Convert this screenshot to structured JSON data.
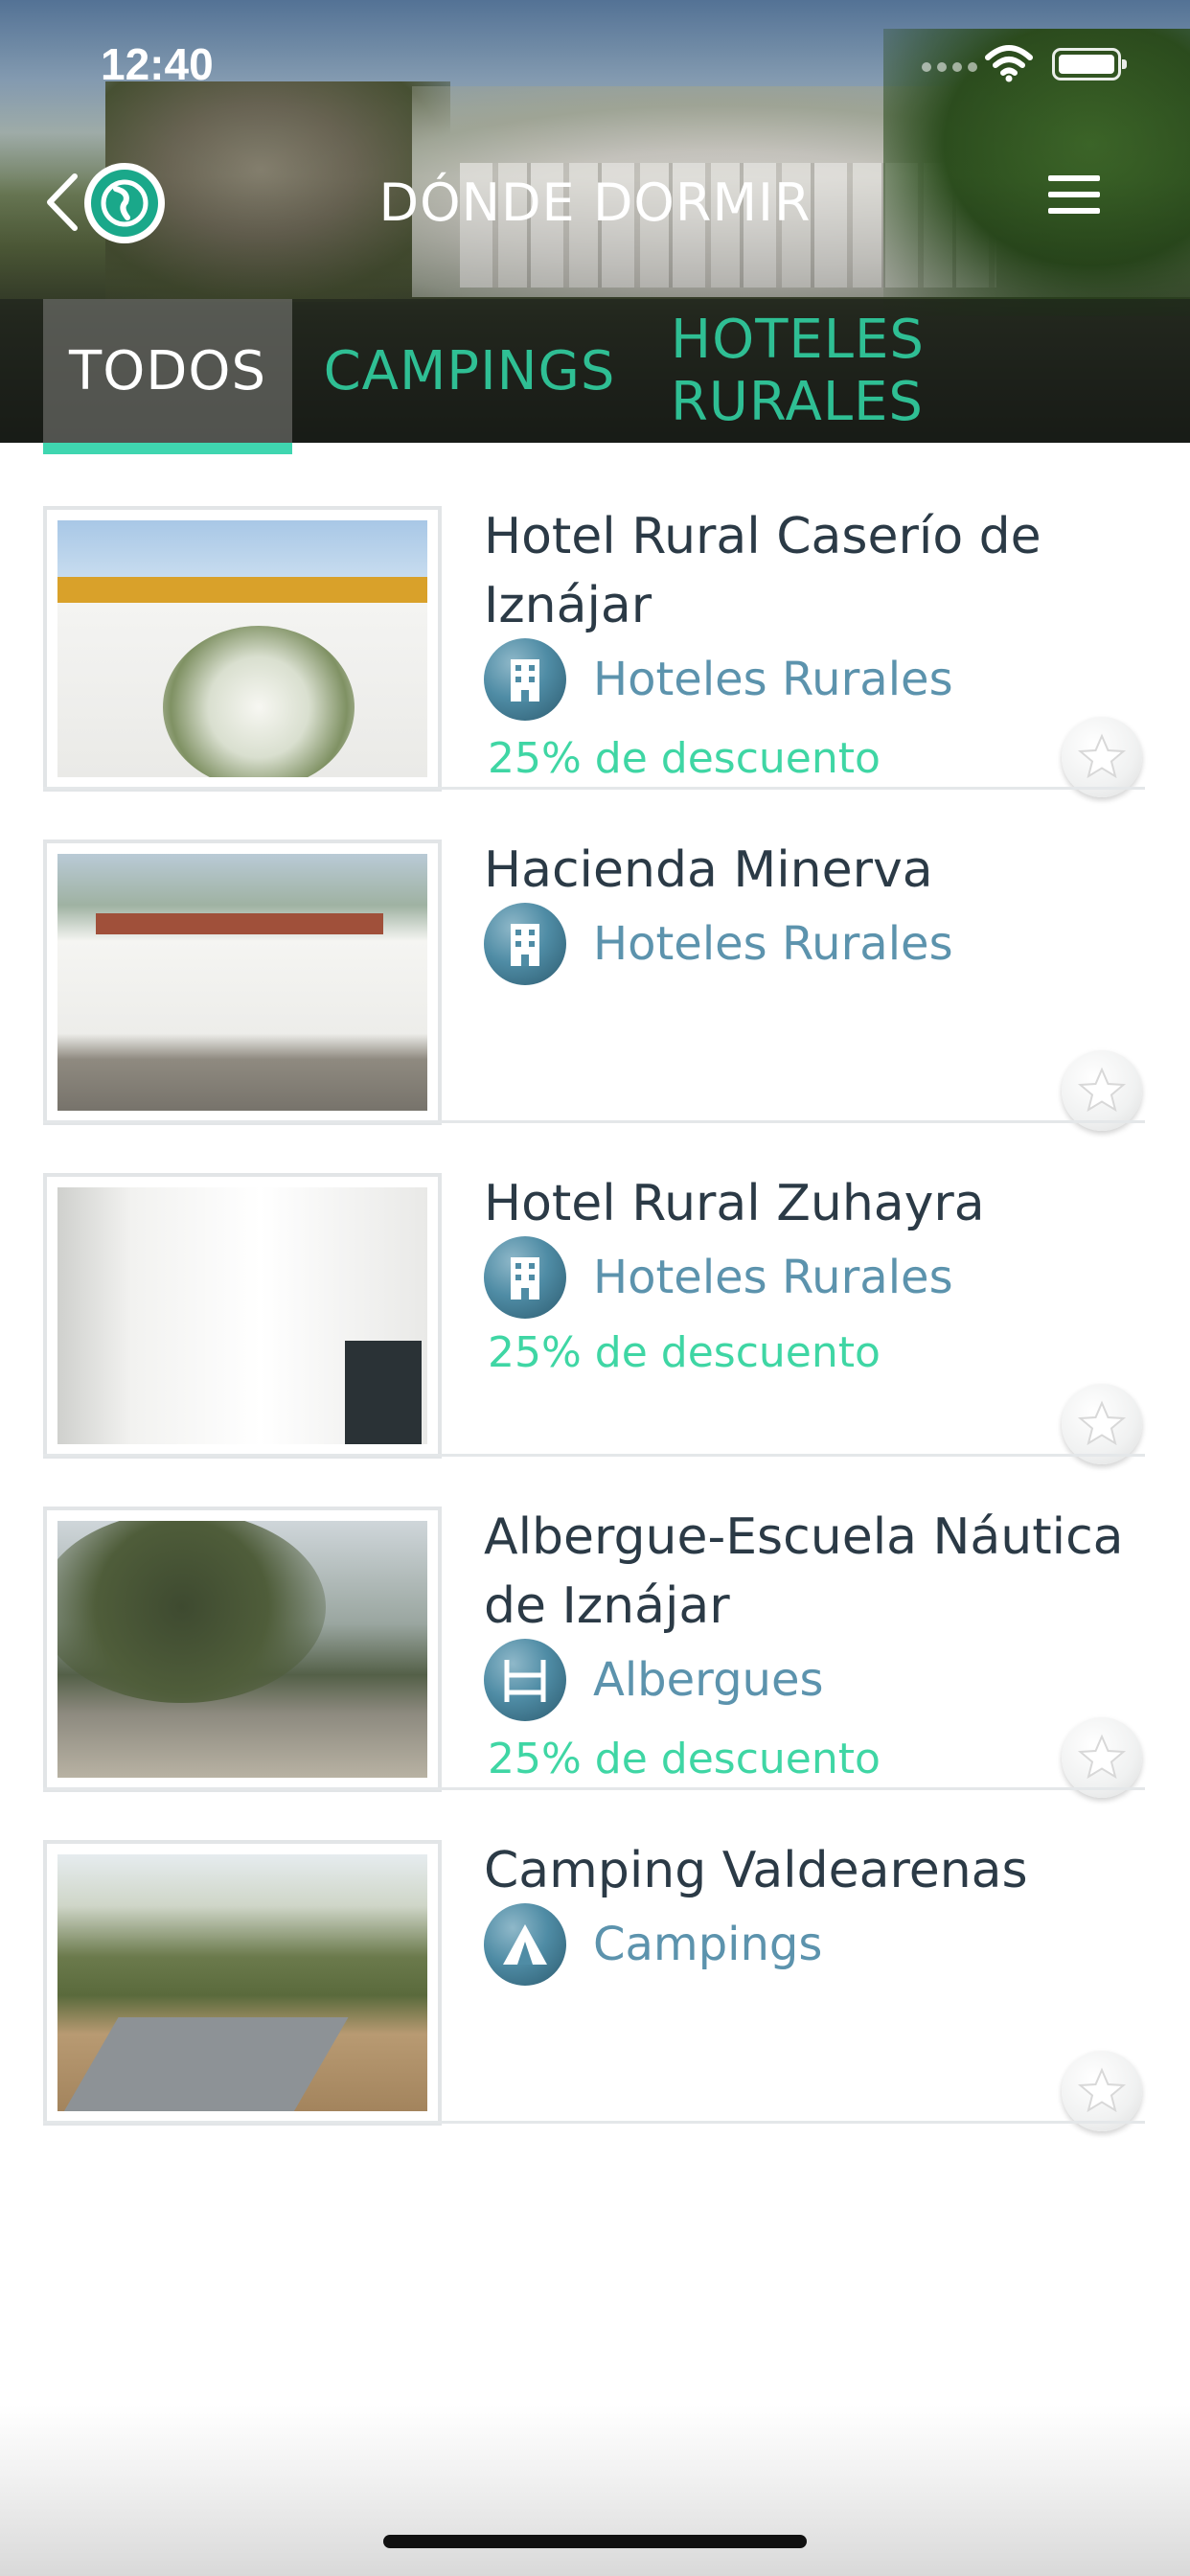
{
  "status_bar": {
    "time": "12:40"
  },
  "header": {
    "title": "DÓNDE DORMIR"
  },
  "tabs": [
    {
      "label": "TODOS",
      "active": true
    },
    {
      "label": "CAMPINGS",
      "active": false
    },
    {
      "label": "HOTELES RURALES",
      "active": false
    }
  ],
  "colors": {
    "accent": "#3fd6b0",
    "tab_inactive": "#2fbf94",
    "category_text": "#5c93ad",
    "discount_text": "#3fd6a4",
    "title_text": "#2b3a46"
  },
  "items": [
    {
      "title": "Hotel Rural Caserío de Iznájar",
      "category": "Hoteles Rurales",
      "category_icon": "building-icon",
      "discount": "25% de descuento"
    },
    {
      "title": "Hacienda Minerva",
      "category": "Hoteles Rurales",
      "category_icon": "building-icon",
      "discount": ""
    },
    {
      "title": "Hotel Rural Zuhayra",
      "category": "Hoteles Rurales",
      "category_icon": "building-icon",
      "discount": "25% de descuento"
    },
    {
      "title": "Albergue-Escuela Náutica de Iznájar",
      "category": "Albergues",
      "category_icon": "bunk-bed-icon",
      "discount": "25% de descuento"
    },
    {
      "title": "Camping Valdearenas",
      "category": "Campings",
      "category_icon": "tent-icon",
      "discount": ""
    }
  ]
}
